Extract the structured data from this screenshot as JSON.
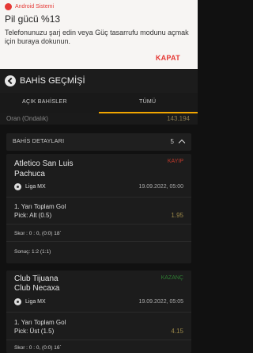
{
  "notification": {
    "app": "Android Sistemi",
    "title": "Pil gücü %13",
    "body": "Telefonunuzu şarj edin veya Güç tasarrufu modunu açmak için buraya dokunun.",
    "action": "KAPAT",
    "accent": "#e53935"
  },
  "header": {
    "title": "BAHİS GEÇMİŞİ"
  },
  "tabs": [
    {
      "label": "AÇIK BAHİSLER"
    },
    {
      "label": "TÜMÜ"
    }
  ],
  "active_tab": "TÜMÜ",
  "odds_row": {
    "label": "Oran (Ondalık)",
    "value": "143.194"
  },
  "details": {
    "label": "BAHİS DETAYLARI",
    "count": "5"
  },
  "bets": [
    {
      "home": "Atletico San Luis",
      "away": "Pachuca",
      "status": "KAYIP",
      "status_color": "#c0392b",
      "league": "Liga MX",
      "date": "19.09.2022, 05:00",
      "market": "1. Yarı Toplam Gol",
      "pick": "Pick: Alt (0.5)",
      "odds": "1.95",
      "score": "Skor : 0 : 0, (0:0) 18`",
      "result": "Sonuç: 1:2 (1:1)"
    },
    {
      "home": "Club Tijuana",
      "away": "Club Necaxa",
      "status": "KAZANÇ",
      "status_color": "#2e7d32",
      "league": "Liga MX",
      "date": "19.09.2022, 05:05",
      "market": "1. Yarı Toplam Gol",
      "pick": "Pick: Üst (1.5)",
      "odds": "4.15",
      "score": "Skor : 0 : 0, (0:0) 16`"
    }
  ]
}
